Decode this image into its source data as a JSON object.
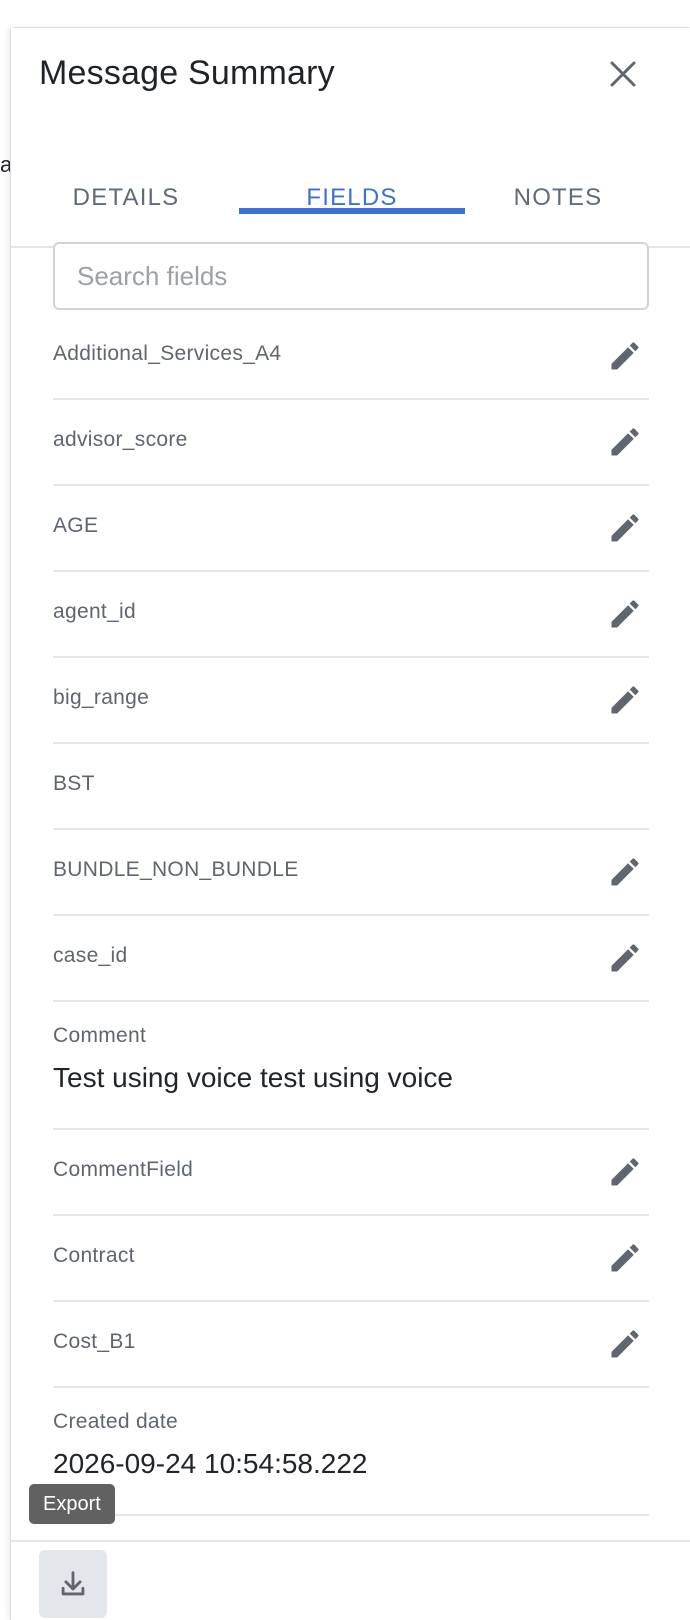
{
  "background": {
    "peek_text": "a"
  },
  "panel": {
    "title": "Message Summary",
    "close_icon": "close-icon"
  },
  "tabs": [
    {
      "label": "DETAILS",
      "active": false
    },
    {
      "label": "FIELDS",
      "active": true
    },
    {
      "label": "NOTES",
      "active": false
    }
  ],
  "search": {
    "placeholder": "Search fields",
    "value": ""
  },
  "fields": [
    {
      "label": "Additional_Services_A4",
      "editable": true
    },
    {
      "label": "advisor_score",
      "editable": true
    },
    {
      "label": "AGE",
      "editable": true
    },
    {
      "label": "agent_id",
      "editable": true
    },
    {
      "label": "big_range",
      "editable": true
    },
    {
      "label": "BST",
      "editable": false
    },
    {
      "label": "BUNDLE_NON_BUNDLE",
      "editable": true
    },
    {
      "label": "case_id",
      "editable": true
    },
    {
      "label": "Comment",
      "value": "Test using voice test using voice",
      "editable": false
    },
    {
      "label": "CommentField",
      "editable": true
    },
    {
      "label": "Contract",
      "editable": true
    },
    {
      "label": "Cost_B1",
      "editable": true
    },
    {
      "label": "Created date",
      "value": "2026-09-24 10:54:58.222",
      "editable": false
    }
  ],
  "footer": {
    "export_tooltip": "Export",
    "export_icon": "download-icon"
  },
  "colors": {
    "accent": "#3b72d6",
    "icon_gray": "#5f6670",
    "divider": "#e3e6ea"
  }
}
